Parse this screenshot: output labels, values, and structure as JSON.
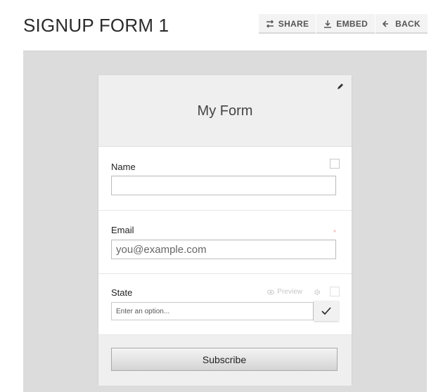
{
  "header": {
    "title": "SIGNUP FORM 1",
    "actions": [
      {
        "label": "SHARE",
        "icon": "share-icon"
      },
      {
        "label": "EMBED",
        "icon": "download-icon"
      },
      {
        "label": "BACK",
        "icon": "back-arrow-icon"
      }
    ]
  },
  "form": {
    "title": "My Form",
    "fields": {
      "name": {
        "label": "Name",
        "value": "",
        "placeholder": ""
      },
      "email": {
        "label": "Email",
        "placeholder": "you@example.com",
        "required_mark": "*"
      },
      "state": {
        "label": "State",
        "preview_label": "Preview",
        "option_placeholder": "Enter an option..."
      }
    },
    "submit_label": "Subscribe"
  },
  "colors": {
    "canvas_bg": "#dcdcdc",
    "header_bg": "#efefef",
    "required": "#f4a3a3"
  }
}
